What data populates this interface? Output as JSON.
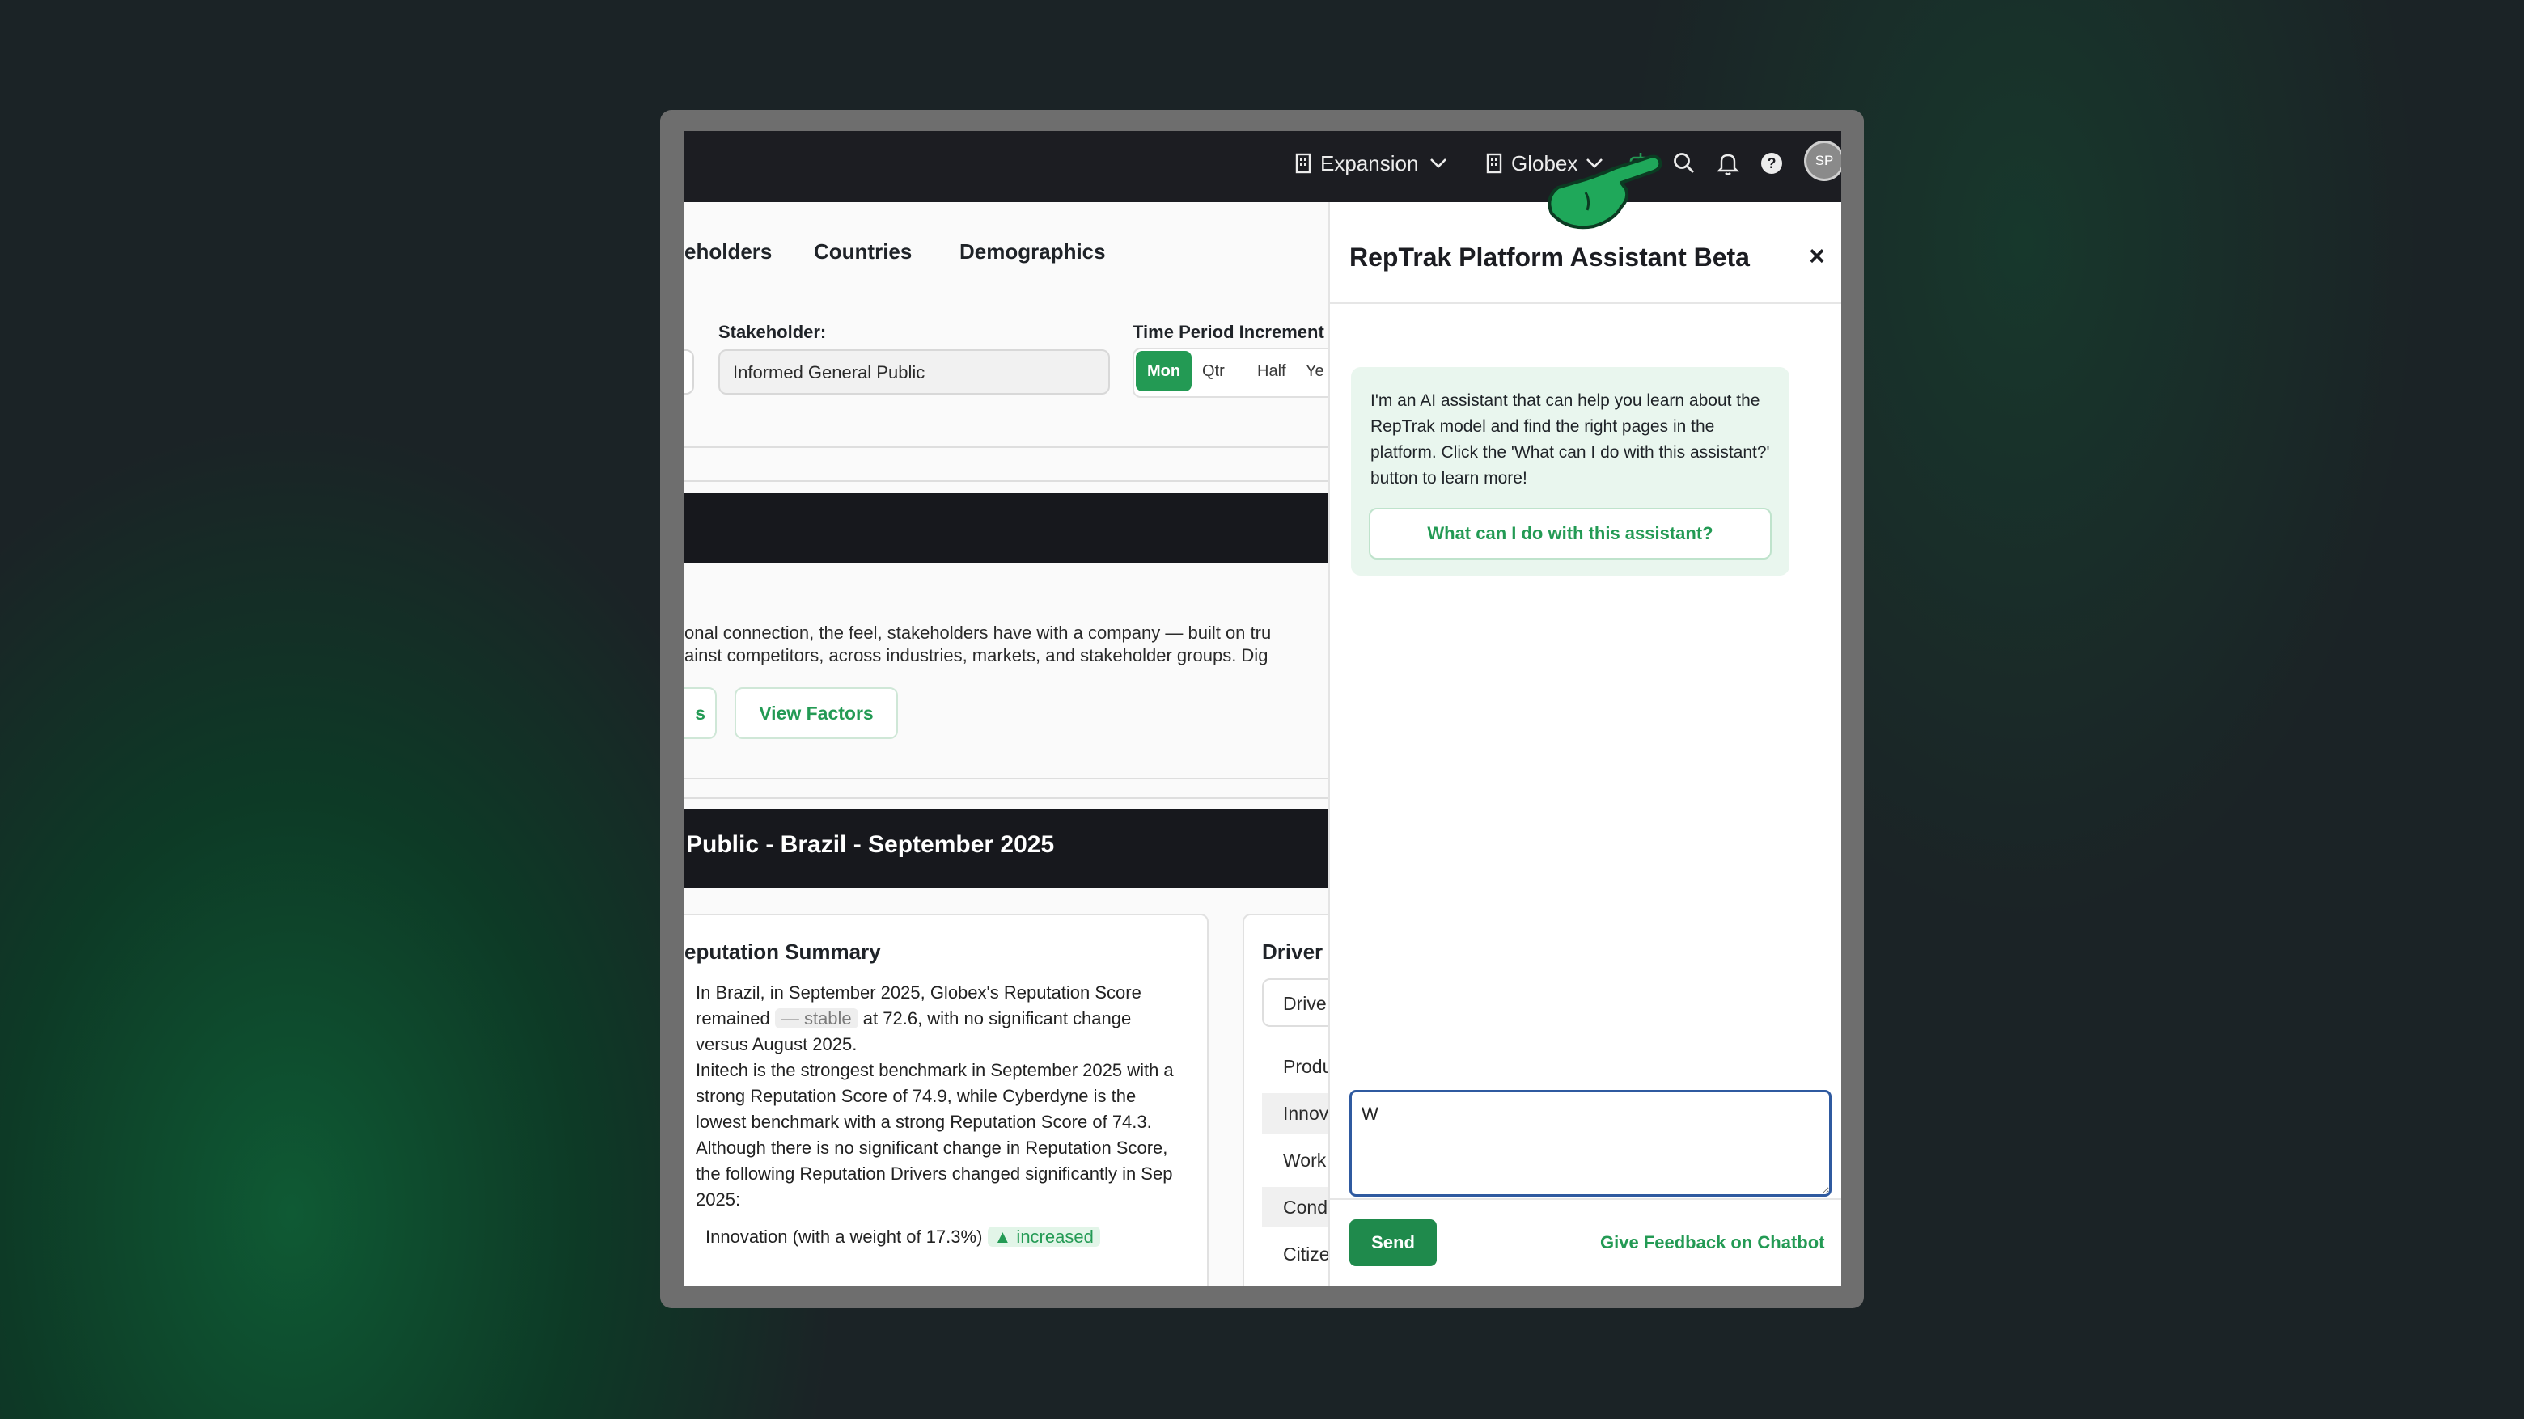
{
  "topbar": {
    "workspace_label": "Expansion",
    "company_label": "Globex",
    "avatar_initials": "SP",
    "icons": [
      "building-icon",
      "chevron-down-icon",
      "chatbot-icon",
      "search-icon",
      "bell-icon",
      "help-icon"
    ]
  },
  "tabs": [
    "eholders",
    "Countries",
    "Demographics"
  ],
  "filters": {
    "stakeholder_label": "Stakeholder:",
    "stakeholder_value": "Informed General Public",
    "time_label": "Time Period Increment",
    "time_options": [
      "Mon",
      "Qtr",
      "Half",
      "Ye"
    ],
    "time_selected": "Mon"
  },
  "intro": {
    "line1": "onal connection, the feel, stakeholders have with a company — built on tru",
    "line2": "ainst competitors, across industries, markets, and stakeholder groups. Dig",
    "partial_button": "s",
    "view_factors_button": "View Factors"
  },
  "section_title": "Public - Brazil - September 2025",
  "reputation_summary": {
    "title": "Reputation Summary",
    "title_visible": "eputation Summary",
    "p1_before": "In Brazil, in September 2025, Globex's Reputation Score remained ",
    "p1_badge": "— stable",
    "p1_after": " at 72.6, with no significant change versus August 2025.",
    "p2": "Initech is the strongest benchmark in September 2025 with a strong Reputation Score of 74.9, while Cyberdyne is the lowest benchmark with a strong Reputation Score of 74.3.",
    "p3": "Although there is no significant change in Reputation Score, the following Reputation Drivers changed significantly in Sep 2025:",
    "bullet_text": "Innovation (with a weight of 17.3%)",
    "bullet_badge": "▲ increased"
  },
  "drivers": {
    "title": "Driver",
    "button": "Drive",
    "rows": [
      "Produ",
      "Innov",
      "Work",
      "Cond",
      "Citize"
    ]
  },
  "assistant": {
    "title": "RepTrak Platform Assistant Beta",
    "close_label": "×",
    "intro_message": "I'm an AI assistant that can help you learn about the RepTrak model and find the right pages in the platform. Click the 'What can I do with this assistant?' button to learn more!",
    "help_button": "What can I do with this assistant?",
    "input_value": "W",
    "send_label": "Send",
    "feedback_link": "Give Feedback on Chatbot"
  },
  "colors": {
    "accent_green": "#239a54",
    "dark_bar": "#1c1d22",
    "input_focus": "#2f5aa0"
  }
}
